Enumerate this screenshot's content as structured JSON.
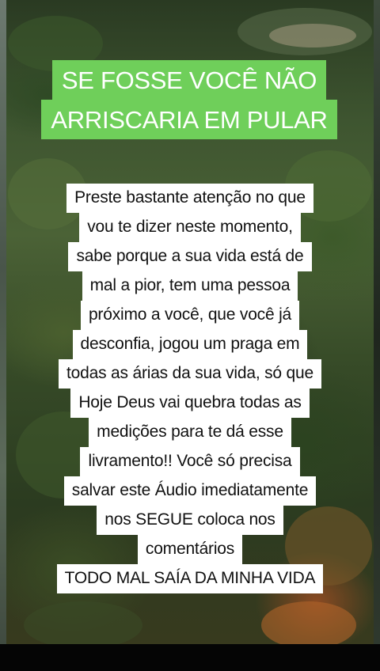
{
  "headline": {
    "line1": "SE FOSSE VOCÊ NÃO",
    "line2": "ARRISCARIA EM PULAR"
  },
  "body": {
    "lines": [
      "Preste bastante atenção no que",
      "vou te dizer neste momento,",
      "sabe porque a sua vida está de",
      "mal a pior, tem uma pessoa",
      "próximo a você, que você já",
      "desconfia, jogou um praga em",
      "todas as árias da sua vida, só que",
      "Hoje Deus vai quebra todas as",
      "medições para te dá esse",
      "livramento!! Você só precisa",
      "salvar este Áudio imediatamente",
      "nos SEGUE coloca nos",
      "comentários",
      "TODO MAL SAÍA DA MINHA VIDA"
    ]
  },
  "colors": {
    "headline_bg": "#6fcf5a",
    "headline_text": "#ffffff",
    "body_bg": "#ffffff",
    "body_text": "#111111"
  }
}
